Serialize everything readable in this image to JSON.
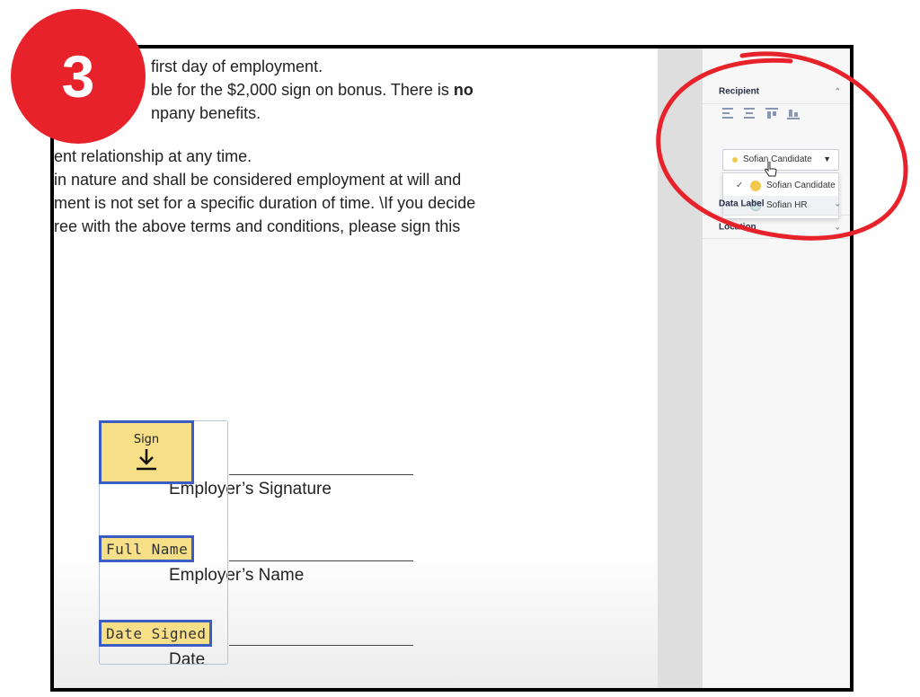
{
  "step_badge": {
    "number": "3",
    "color": "#e8222a"
  },
  "document": {
    "lines": [
      {
        "text": "first day of employment."
      },
      {
        "text": "ble for the $2,000 sign on bonus. There is ",
        "bold": "no"
      },
      {
        "text": "npany benefits."
      },
      {
        "text": "ent relationship at any time."
      },
      {
        "text": "in nature and shall be considered employment at will and"
      },
      {
        "text": "ment is not set for a specific duration of time. \\If you decide"
      },
      {
        "text": "ree with the above terms and conditions, please sign this"
      }
    ],
    "signature_label": "Employer’s Signature",
    "name_label": "Employer’s Name",
    "date_label": "Date"
  },
  "fields": {
    "sign_label": "Sign",
    "full_name": "Full Name",
    "date_signed": "Date Signed",
    "field_color": "#f6df86",
    "border_color": "#3b5cc4"
  },
  "panel": {
    "recipient_section": "Recipient",
    "recipient_selected": "Sofian Candidate",
    "recipient_options": [
      {
        "label": "Sofian Candidate",
        "checked": true,
        "color": "#f2c94c"
      },
      {
        "label": "Sofian HR",
        "checked": false,
        "color": "#cfe3e8"
      }
    ],
    "data_label_section": "Data Label",
    "location_section": "Location"
  },
  "annotation": {
    "color": "#e8222a"
  }
}
